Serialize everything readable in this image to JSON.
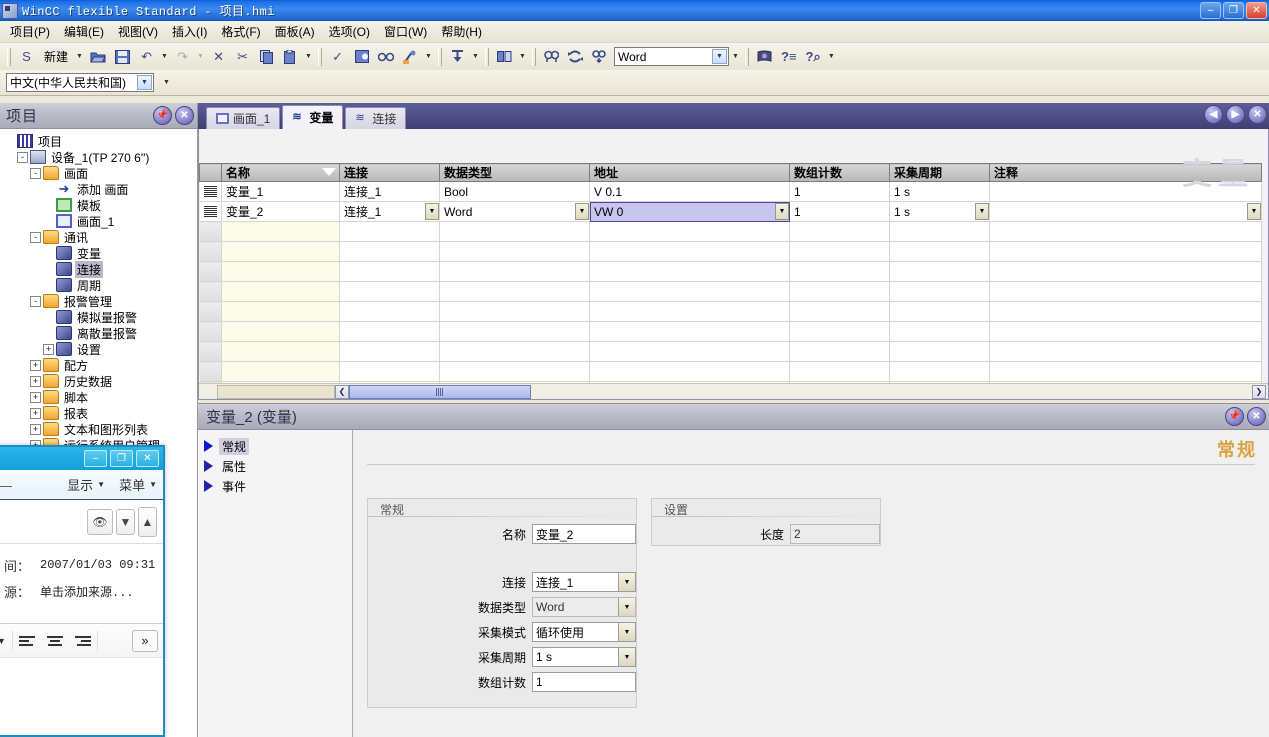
{
  "window": {
    "title": "WinCC flexible Standard - 项目.hmi",
    "app_icon": "wincc-icon",
    "buttons": {
      "minimize": "–",
      "restore": "❐",
      "close": "✕"
    }
  },
  "menubar": {
    "items": [
      {
        "label": "项目(P)"
      },
      {
        "label": "编辑(E)"
      },
      {
        "label": "视图(V)"
      },
      {
        "label": "插入(I)"
      },
      {
        "label": "格式(F)"
      },
      {
        "label": "面板(A)"
      },
      {
        "label": "选项(O)"
      },
      {
        "label": "窗口(W)"
      },
      {
        "label": "帮助(H)"
      }
    ]
  },
  "toolbar": {
    "new_label": "新建",
    "buttons": [
      {
        "name": "new-icon",
        "glyph": "S"
      },
      {
        "name": "open-icon",
        "glyph": "📂"
      },
      {
        "name": "save-icon",
        "glyph": "💾"
      },
      {
        "name": "undo-icon",
        "glyph": "↶"
      },
      {
        "name": "redo-icon",
        "glyph": "↷"
      },
      {
        "name": "delete-icon",
        "glyph": "✕"
      },
      {
        "name": "cut-icon",
        "glyph": "✂"
      },
      {
        "name": "copy-icon",
        "glyph": "❐"
      },
      {
        "name": "paste-icon",
        "glyph": "📋"
      },
      {
        "name": "check-consistency-icon",
        "glyph": "✓"
      },
      {
        "name": "generate-icon",
        "glyph": "▣"
      },
      {
        "name": "runtime-icon",
        "glyph": "👓"
      },
      {
        "name": "transfer-icon",
        "glyph": "📡"
      },
      {
        "name": "download-icon",
        "glyph": "⤓"
      },
      {
        "name": "compare-icon",
        "glyph": "▥"
      },
      {
        "name": "find-icon",
        "glyph": "🔍"
      },
      {
        "name": "refresh-icon",
        "glyph": "⟳"
      },
      {
        "name": "find-replace-icon",
        "glyph": "🔎"
      },
      {
        "name": "library-icon",
        "glyph": "📕"
      },
      {
        "name": "help-index-icon",
        "glyph": "?"
      },
      {
        "name": "help-search-icon",
        "glyph": "?"
      }
    ],
    "language_combo": {
      "value": "中文(中华人民共和国)"
    },
    "datatype_combo": {
      "value": "Word"
    }
  },
  "project_panel": {
    "title": "项目",
    "pin_icon": "pin-icon",
    "close_icon": "close-icon",
    "tree": [
      {
        "label": "项目",
        "indent": 0,
        "expander": "",
        "icon": "project-icon"
      },
      {
        "label": "设备_1(TP 270 6'')",
        "indent": 1,
        "expander": "-",
        "icon": "device-icon"
      },
      {
        "label": "画面",
        "indent": 2,
        "expander": "-",
        "icon": "folder-icon"
      },
      {
        "label": "添加 画面",
        "indent": 3,
        "expander": "",
        "icon": "add-arrow-icon"
      },
      {
        "label": "模板",
        "indent": 3,
        "expander": "",
        "icon": "template-icon"
      },
      {
        "label": "画面_1",
        "indent": 3,
        "expander": "",
        "icon": "screen-icon"
      },
      {
        "label": "通讯",
        "indent": 2,
        "expander": "-",
        "icon": "folder-icon"
      },
      {
        "label": "变量",
        "indent": 3,
        "expander": "",
        "icon": "tags-icon"
      },
      {
        "label": "连接",
        "indent": 3,
        "expander": "",
        "icon": "connection-icon",
        "selected": true
      },
      {
        "label": "周期",
        "indent": 3,
        "expander": "",
        "icon": "cycle-icon"
      },
      {
        "label": "报警管理",
        "indent": 2,
        "expander": "-",
        "icon": "folder-icon"
      },
      {
        "label": "模拟量报警",
        "indent": 3,
        "expander": "",
        "icon": "analog-alarm-icon"
      },
      {
        "label": "离散量报警",
        "indent": 3,
        "expander": "",
        "icon": "discrete-alarm-icon"
      },
      {
        "label": "设置",
        "indent": 3,
        "expander": "+",
        "icon": "settings-icon"
      },
      {
        "label": "配方",
        "indent": 2,
        "expander": "+",
        "icon": "folder-icon"
      },
      {
        "label": "历史数据",
        "indent": 2,
        "expander": "+",
        "icon": "folder-icon"
      },
      {
        "label": "脚本",
        "indent": 2,
        "expander": "+",
        "icon": "folder-icon"
      },
      {
        "label": "报表",
        "indent": 2,
        "expander": "+",
        "icon": "folder-icon"
      },
      {
        "label": "文本和图形列表",
        "indent": 2,
        "expander": "+",
        "icon": "folder-icon"
      },
      {
        "label": "运行系统用户管理",
        "indent": 2,
        "expander": "+",
        "icon": "folder-icon"
      }
    ]
  },
  "editor": {
    "tabs": [
      {
        "label": "画面_1",
        "icon": "screen-icon",
        "active": false
      },
      {
        "label": "变量",
        "icon": "tags-icon",
        "active": true
      },
      {
        "label": "连接",
        "icon": "connection-icon",
        "active": false
      }
    ],
    "nav": {
      "prev": "◀",
      "next": "▶",
      "close": "✕"
    },
    "watermark": "变量",
    "grid": {
      "columns": [
        "名称",
        "连接",
        "数据类型",
        "地址",
        "数组计数",
        "采集周期",
        "注释"
      ],
      "sorted_column": "名称",
      "rows": [
        {
          "名称": "变量_1",
          "连接": "连接_1",
          "数据类型": "Bool",
          "地址": "V 0.1",
          "数组计数": "1",
          "采集周期": "1 s",
          "注释": "",
          "selected": false
        },
        {
          "名称": "变量_2",
          "连接": "连接_1",
          "数据类型": "Word",
          "地址": "VW 0",
          "数组计数": "1",
          "采集周期": "1 s",
          "注释": "",
          "selected": true,
          "editing_cell": "地址"
        }
      ]
    },
    "hscroll": {
      "left_arrow": "❮",
      "right_arrow": "❯"
    }
  },
  "properties": {
    "title": "变量_2 (变量)",
    "pin_icon": "pin-icon",
    "close_icon": "close-icon",
    "watermark": "常规",
    "nav": [
      {
        "label": "常规",
        "active": true
      },
      {
        "label": "属性",
        "active": false
      },
      {
        "label": "事件",
        "active": false
      }
    ],
    "general_group": {
      "title": "常规",
      "fields": [
        {
          "label": "名称",
          "value": "变量_2",
          "type": "text"
        },
        {
          "label": "连接",
          "value": "连接_1",
          "type": "combo"
        },
        {
          "label": "数据类型",
          "value": "Word",
          "type": "combo",
          "readonly": true
        },
        {
          "label": "采集模式",
          "value": "循环使用",
          "type": "combo"
        },
        {
          "label": "采集周期",
          "value": "1 s",
          "type": "combo"
        },
        {
          "label": "数组计数",
          "value": "1",
          "type": "text"
        }
      ]
    },
    "settings_group": {
      "title": "设置",
      "fields": [
        {
          "label": "长度",
          "value": "2",
          "type": "text",
          "readonly": true
        }
      ]
    }
  },
  "float_window": {
    "buttons": {
      "minimize": "–",
      "restore": "❐",
      "close": "✕"
    },
    "menu": [
      {
        "label": "显示",
        "caret": "▼"
      },
      {
        "label": "菜单",
        "caret": "▼"
      }
    ],
    "tool_icons": [
      {
        "name": "eye-icon",
        "glyph": "👁"
      },
      {
        "name": "dropdown-caret-icon",
        "glyph": "▼"
      },
      {
        "name": "scroll-up-icon",
        "glyph": "▲"
      }
    ],
    "rows": [
      {
        "label": "间：",
        "value": "2007/01/03 09:31"
      },
      {
        "label": "源：",
        "value": "单击添加来源..."
      }
    ],
    "align_icons": [
      {
        "name": "dropdown-caret-icon",
        "glyph": "▼"
      },
      {
        "name": "align-left-icon"
      },
      {
        "name": "align-center-icon"
      },
      {
        "name": "align-right-icon"
      },
      {
        "name": "expand-more-icon",
        "glyph": "»"
      }
    ]
  },
  "colors": {
    "title_blue": "#1b6fe6",
    "panel_header": "#b9b9c6",
    "tab_strip": "#4f4f86",
    "selection": "#c6c6ee",
    "accent_orange": "#d9a441",
    "float_cyan": "#12a0db"
  }
}
